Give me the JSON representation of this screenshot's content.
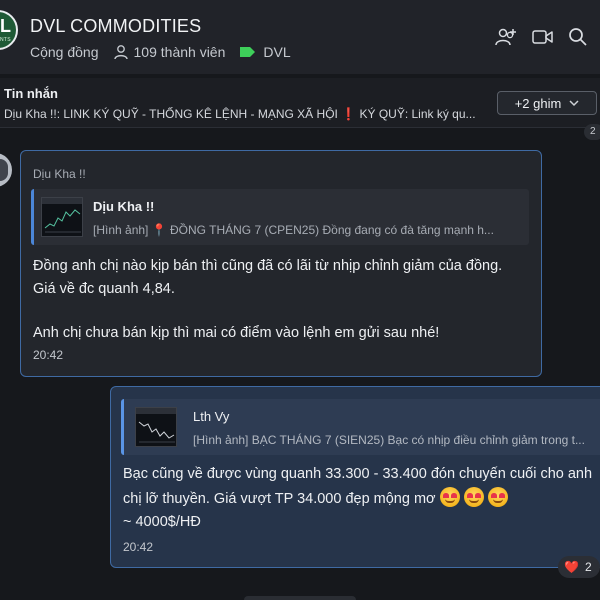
{
  "header": {
    "group_name": "DVL COMMODITIES",
    "avatar_letter": "L",
    "avatar_small": "NTS",
    "community_label": "Cộng đồng",
    "members_label": "109 thành viên",
    "tag_label": "DVL",
    "tag_color": "#3ecf5a",
    "icons": [
      "add-member-icon",
      "video-call-icon",
      "search-icon"
    ]
  },
  "pinned": {
    "title": "Tin nhắn",
    "text_before": "Dịu Kha !!: LINK KÝ QUỸ - THỐNG KÊ LỆNH - MẠNG XÃ HỘI ",
    "text_excl": "❗",
    "text_after": " KÝ QUỸ: Link ký qu...",
    "more_pins_label": "+2 ghim",
    "side_chip": "2"
  },
  "messages": [
    {
      "sender": "Dịu Kha !!",
      "quote": {
        "name": "Dịu Kha !!",
        "preview_prefix": "[Hình ảnh] ",
        "preview_pin": "📍",
        "preview_text": " ĐỒNG THÁNG 7 (CPEN25) Đồng đang có đà tăng mạnh h..."
      },
      "lines": [
        "Đồng anh chị nào kịp bán thì cũng đã có lãi từ nhịp chỉnh giảm của đồng.",
        "Giá về đc quanh 4,84.",
        "Anh chị chưa bán kịp thì mai có điểm vào lệnh em gửi sau nhé!"
      ],
      "time": "20:42"
    },
    {
      "quote": {
        "name": "Lth Vy",
        "preview": "[Hình ảnh] BẠC THÁNG 7 (SIEN25) Bạc có nhịp điều chỉnh giảm trong t..."
      },
      "lines": [
        "Bạc cũng về được vùng quanh 33.300 - 33.400 đón chuyến cuối cho anh",
        "chị lỡ thuyền. Giá vượt TP 34.000 đẹp mộng mơ",
        "~ 4000$/HĐ"
      ],
      "time": "20:42",
      "reaction": {
        "emoji": "❤️",
        "count": "2"
      }
    }
  ],
  "colors": {
    "accent_border": "#3f6aa3",
    "quote_bar": "#4b86d8",
    "outgoing_bubble": "#26344a"
  }
}
